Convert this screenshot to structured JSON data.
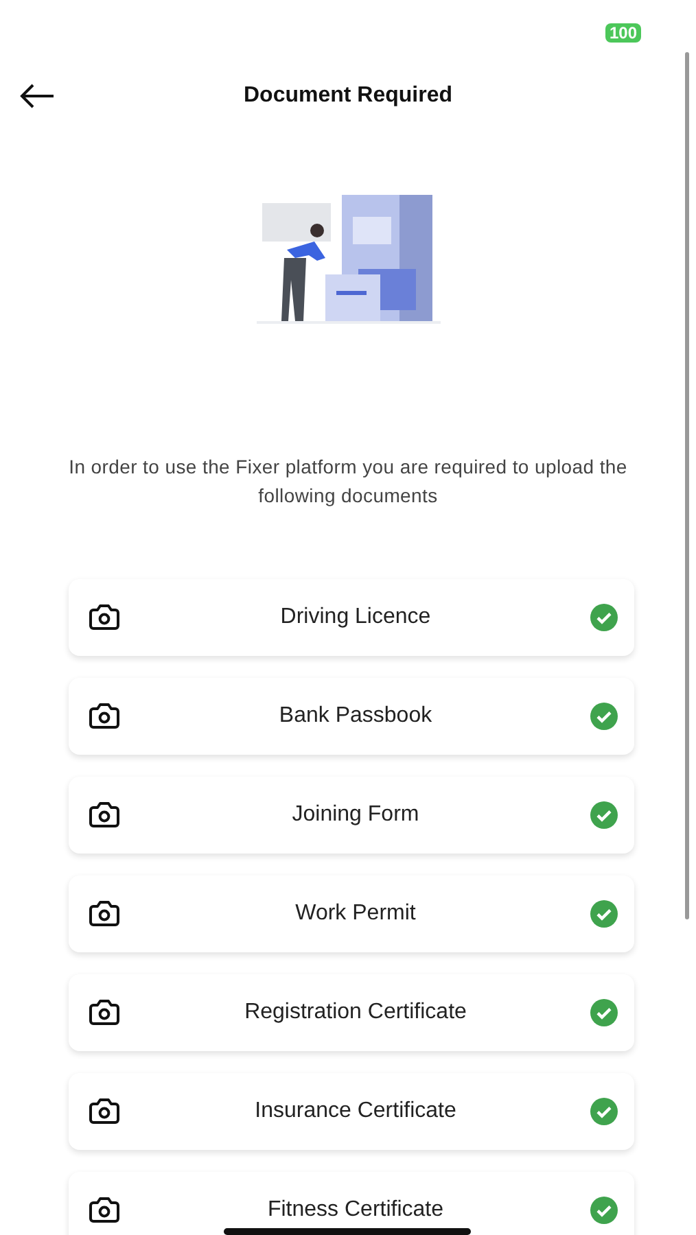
{
  "status_bar": {
    "battery": "100"
  },
  "header": {
    "title": "Document Required"
  },
  "intro": "In order to use the Fixer platform you are required to upload the following documents",
  "documents": [
    {
      "label": "Driving Licence",
      "uploaded": true
    },
    {
      "label": "Bank Passbook",
      "uploaded": true
    },
    {
      "label": "Joining Form",
      "uploaded": true
    },
    {
      "label": "Work Permit",
      "uploaded": true
    },
    {
      "label": "Registration Certificate",
      "uploaded": true
    },
    {
      "label": "Insurance Certificate",
      "uploaded": true
    },
    {
      "label": "Fitness Certificate",
      "uploaded": true
    }
  ]
}
